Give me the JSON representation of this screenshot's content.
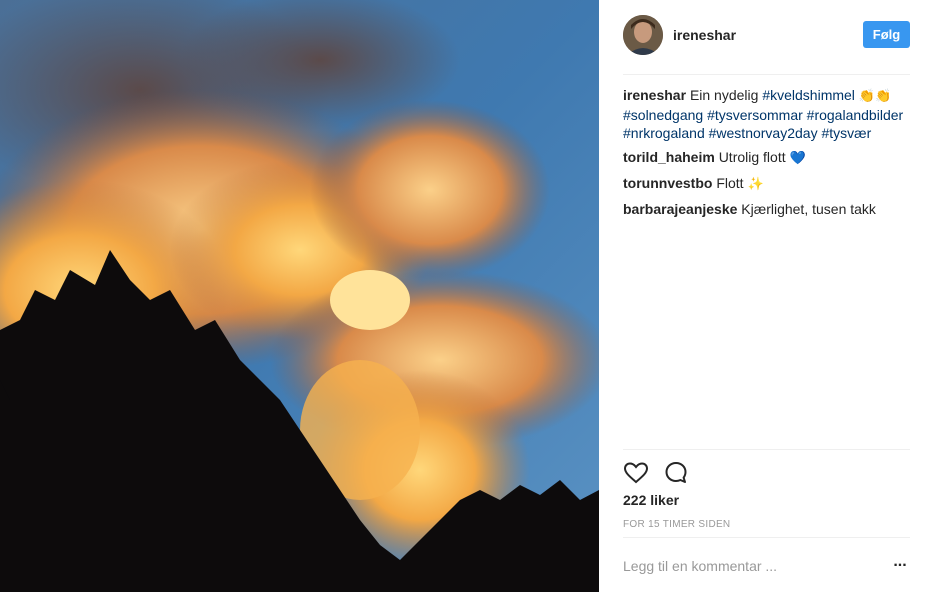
{
  "post": {
    "username": "ireneshar",
    "follow_label": "Følg",
    "caption": {
      "user": "ireneshar",
      "text": "Ein nydelig",
      "tags": [
        "#kveldshimmel",
        "#solnedgang",
        "#tysversommar",
        "#rogalandbilder",
        "#nrkrogaland",
        "#westnorvay2day",
        "#tysvær"
      ],
      "emoji": "👏"
    },
    "comments": [
      {
        "user": "torild_haheim",
        "text": "Utrolig flott",
        "emoji": "💙"
      },
      {
        "user": "torunnvestbo",
        "text": "Flott",
        "emoji": "✨"
      },
      {
        "user": "barbarajeanjeske",
        "text": "Kjærlighet, tusen takk",
        "emoji": ""
      }
    ],
    "likes": "222 liker",
    "timestamp": "FOR 15 TIMER SIDEN",
    "comment_placeholder": "Legg til en kommentar ...",
    "more_label": "..."
  },
  "icons": {
    "like": "heart-icon",
    "comment": "comment-bubble-icon",
    "more": "more-options-icon"
  },
  "colors": {
    "follow_button": "#3897f0",
    "hashtag": "#003569",
    "divider": "#efefef",
    "muted": "#999999"
  }
}
